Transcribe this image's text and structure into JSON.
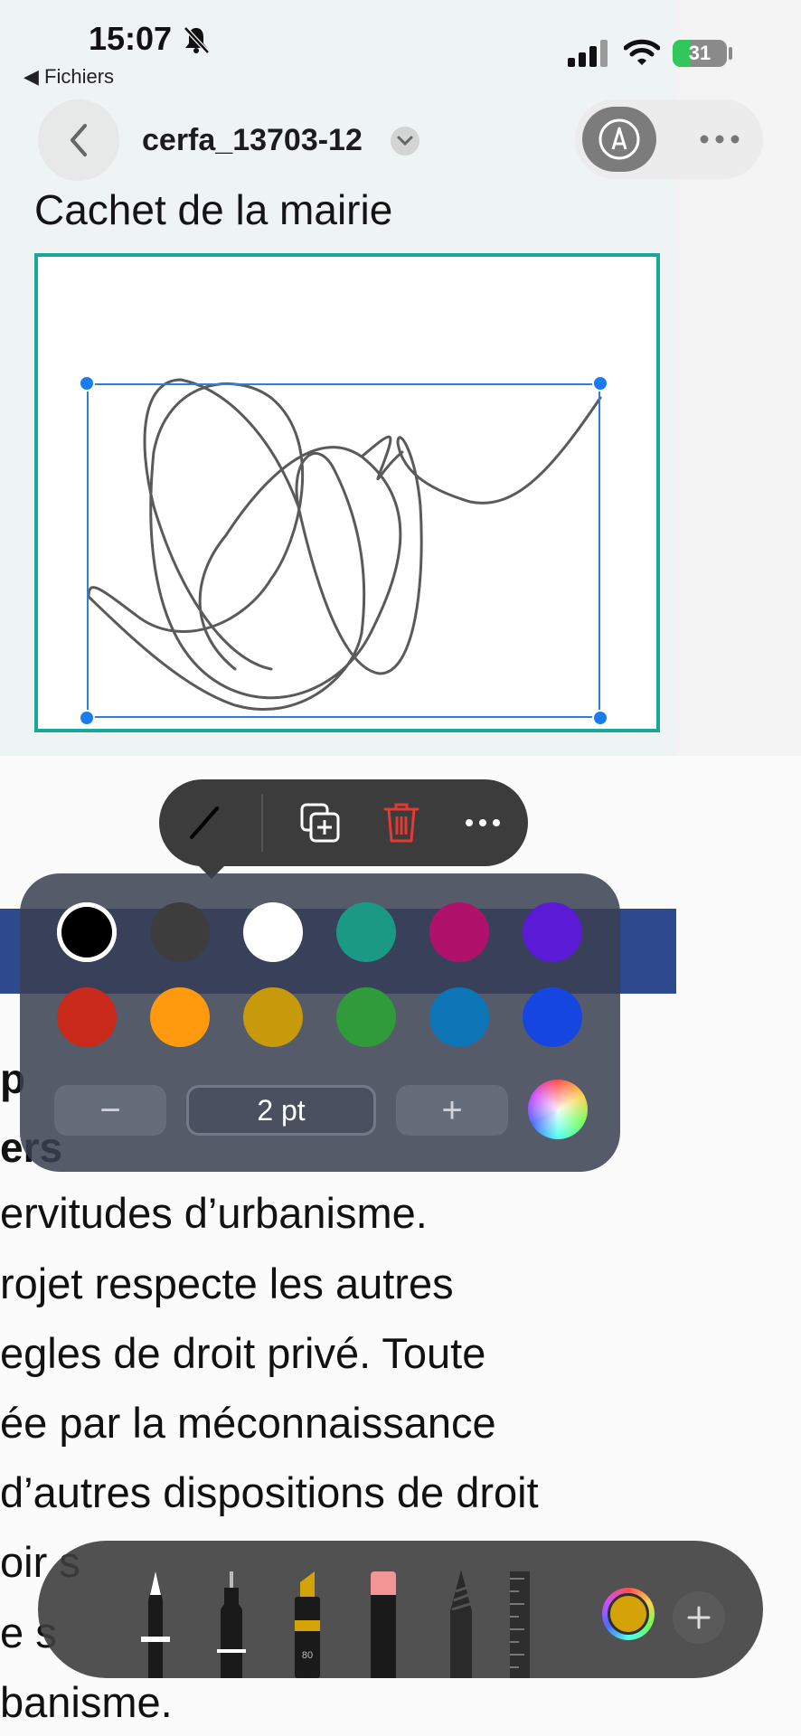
{
  "status_bar": {
    "time": "15:07",
    "back_app": "◀ Fichiers",
    "battery_level": "31",
    "battery_fraction": 0.31
  },
  "nav": {
    "document_title": "cerfa_13703-12"
  },
  "document": {
    "stamp_title": "Cachet de la mairie",
    "bold_fragments": [
      "p",
      "ers"
    ],
    "lines": [
      "ervitudes d’urbanisme.",
      "rojet respecte les autres",
      "egles de droit privé. Toute",
      "ée par la méconnaissance",
      "d’autres dispositions de droit",
      "oir s",
      "e s",
      "banisme."
    ]
  },
  "palette": {
    "colors": [
      "#000000",
      "#3d3d3d",
      "#ffffff",
      "#1a9a85",
      "#b0126b",
      "#5a1ad6",
      "#c92a1c",
      "#ff9a0e",
      "#c69a0a",
      "#2f9b3a",
      "#0d74b5",
      "#1646e0"
    ],
    "selected_index": 0,
    "stroke_size": "2 pt",
    "minus_label": "−",
    "plus_label": "+"
  },
  "tools": {
    "marker_label": "80",
    "current_color": "#d3a307",
    "add_label": "+"
  },
  "colors": {
    "stamp_border": "#1aa79a",
    "selection": "#1a7cf0",
    "delete_red": "#e53935"
  }
}
